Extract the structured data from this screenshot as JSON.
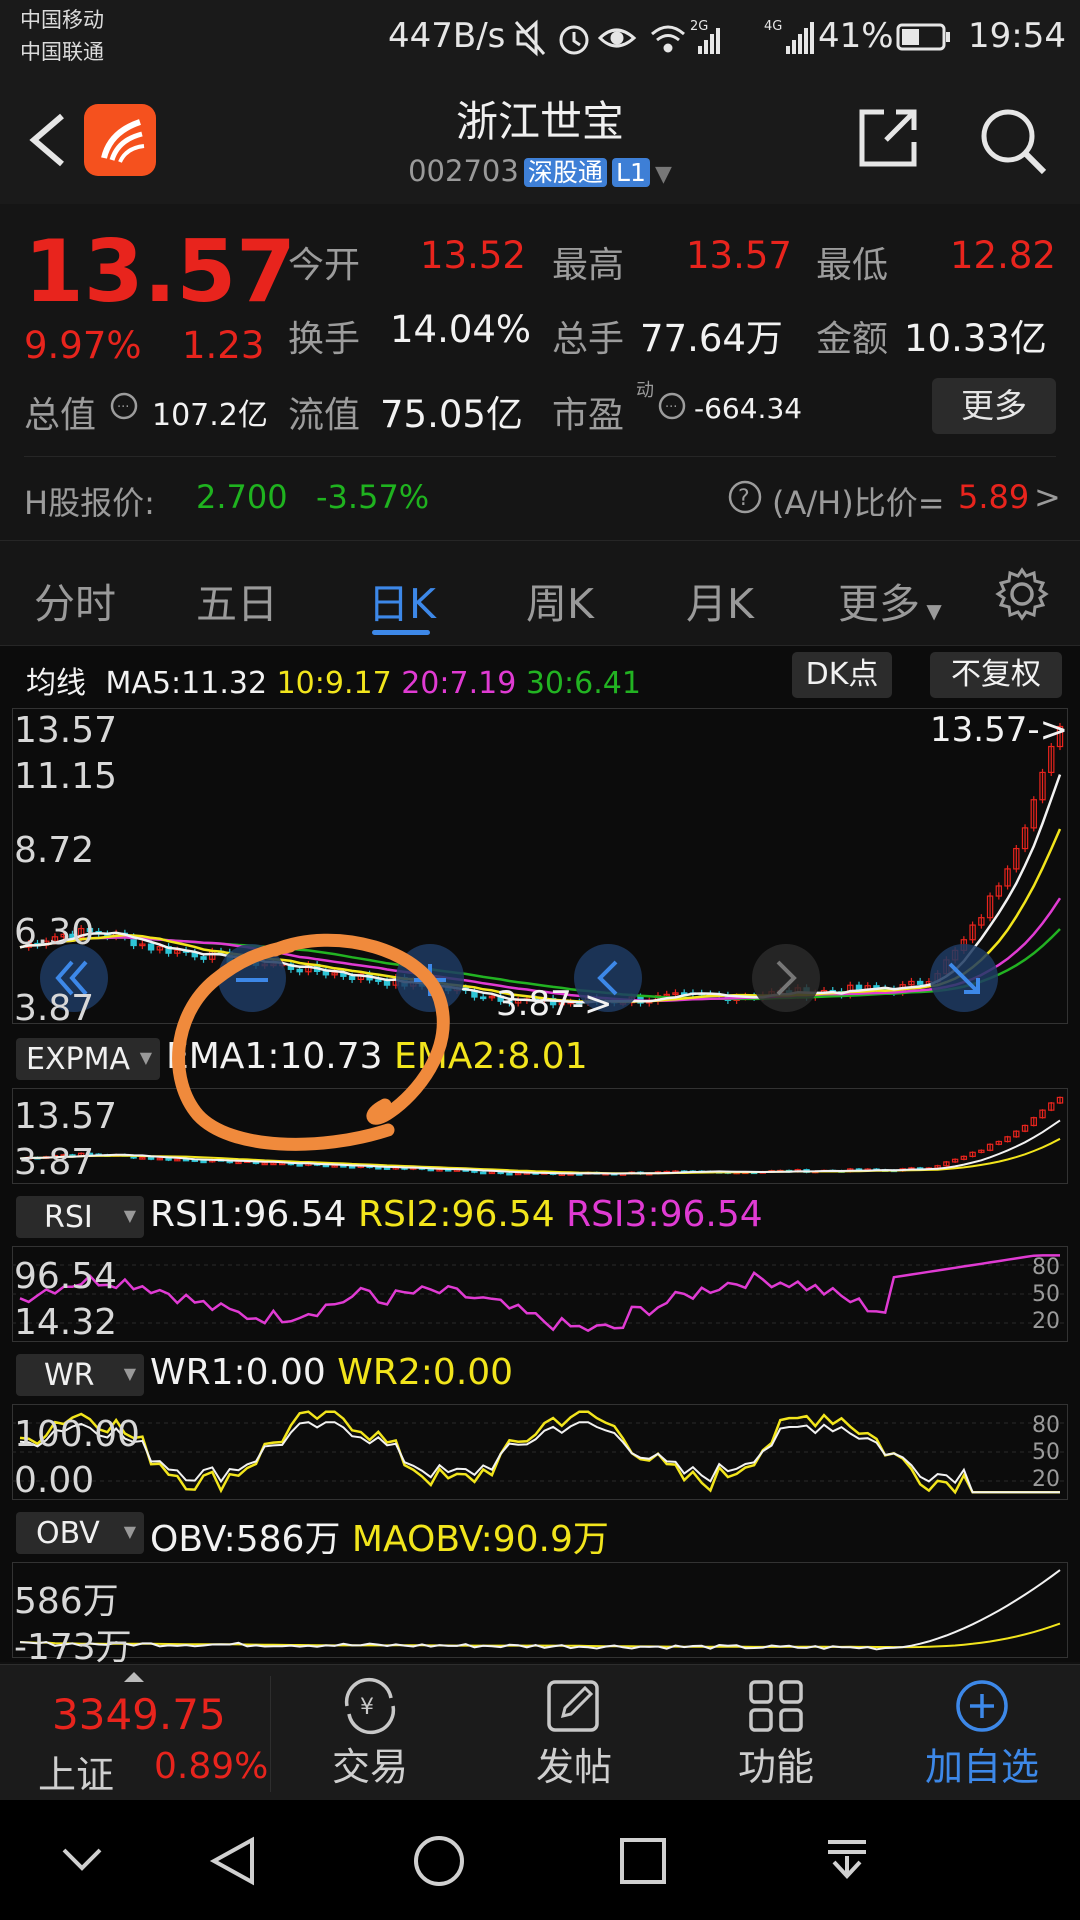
{
  "status": {
    "carrier1": "中国移动",
    "carrier2": "中国联通",
    "net_speed": "447B/s",
    "net_2g": "2G",
    "net_4g": "4G",
    "battery": "41%",
    "time": "19:54"
  },
  "header": {
    "title": "浙江世宝",
    "code": "002703",
    "tag_connect": "深股通",
    "tag_level": "L1"
  },
  "quote": {
    "price": "13.57",
    "change_pct": "9.97%",
    "change": "1.23",
    "open_label": "今开",
    "open": "13.52",
    "high_label": "最高",
    "high": "13.57",
    "low_label": "最低",
    "low": "12.82",
    "turnover_label": "换手",
    "turnover": "14.04%",
    "volume_label": "总手",
    "volume": "77.64万",
    "amount_label": "金额",
    "amount": "10.33亿",
    "mktcap_label": "总值",
    "mktcap": "107.2亿",
    "float_label": "流值",
    "float": "75.05亿",
    "pe_label": "市盈",
    "pe_sup": "动",
    "pe": "-664.34",
    "more": "更多",
    "h_label": "H股报价:",
    "h_price": "2.700",
    "h_change": "-3.57%",
    "ah_label": "(A/H)比价=",
    "ah_value": "5.89",
    "ah_arrow": ">"
  },
  "tabs": [
    "分时",
    "五日",
    "日K",
    "周K",
    "月K",
    "更多"
  ],
  "chart": {
    "ma_label": "均线",
    "ma5": "MA5:11.32",
    "ma10": "10:9.17",
    "ma20": "20:7.19",
    "ma30": "30:6.41",
    "dk_button": "DK点",
    "fq_button": "不复权",
    "price_axis": [
      "13.57",
      "11.15",
      "8.72",
      "6.30",
      "3.87"
    ],
    "last_marker": "13.57->",
    "low_marker": "3.87->",
    "expma_selector": "EXPMA",
    "ema1": "EMA1:10.73",
    "ema2": "EMA2:8.01",
    "expma_axis": [
      "13.57",
      "3.87"
    ],
    "rsi_selector": "RSI",
    "rsi1": "RSI1:96.54",
    "rsi2": "RSI2:96.54",
    "rsi3": "RSI3:96.54",
    "rsi_axis": [
      "96.54",
      "14.32"
    ],
    "rsi_levels": [
      "80",
      "50",
      "20"
    ],
    "wr_selector": "WR",
    "wr1": "WR1:0.00",
    "wr2": "WR2:0.00",
    "wr_axis": [
      "100.00",
      "0.00"
    ],
    "wr_levels": [
      "80",
      "50",
      "20"
    ],
    "obv_selector": "OBV",
    "obv": "OBV:586万",
    "maobv": "MAOBV:90.9万",
    "obv_axis": [
      "586万",
      "-173万"
    ]
  },
  "bottom": {
    "index_value": "3349.75",
    "index_name": "上证",
    "index_change": "0.89%",
    "items": [
      "交易",
      "发帖",
      "功能",
      "加自选"
    ]
  },
  "colors": {
    "up": "#e8241d",
    "down": "#1fb31f",
    "accent": "#3d88e8",
    "ma5": "#f2f2f2",
    "ma10": "#f2e51c",
    "ma20": "#e03bd3",
    "ma30": "#22b322",
    "annotation": "#f08a3c"
  }
}
